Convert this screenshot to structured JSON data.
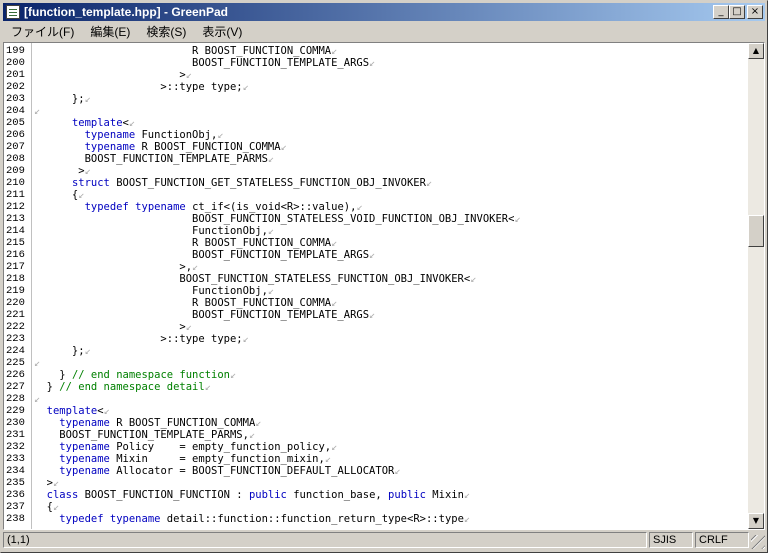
{
  "window": {
    "title": "[function_template.hpp] - GreenPad",
    "minimize": "_",
    "maximize": "□",
    "close": "×"
  },
  "menu": [
    "ファイル(F)",
    "編集(E)",
    "検索(S)",
    "表示(V)"
  ],
  "editor": {
    "eol_marker": "↙",
    "lines": [
      {
        "n": "199",
        "segs": [
          [
            "",
            "                         R BOOST_FUNCTION_COMMA"
          ]
        ]
      },
      {
        "n": "200",
        "segs": [
          [
            "",
            "                         BOOST_FUNCTION_TEMPLATE_ARGS"
          ]
        ]
      },
      {
        "n": "201",
        "segs": [
          [
            "",
            "                       >"
          ]
        ]
      },
      {
        "n": "202",
        "segs": [
          [
            "",
            "                    >::type type;"
          ]
        ]
      },
      {
        "n": "203",
        "segs": [
          [
            "",
            "      };"
          ]
        ]
      },
      {
        "n": "204",
        "segs": []
      },
      {
        "n": "205",
        "segs": [
          [
            "",
            "      "
          ],
          [
            "kw",
            "template"
          ],
          [
            "",
            "<"
          ]
        ]
      },
      {
        "n": "206",
        "segs": [
          [
            "",
            "        "
          ],
          [
            "kw",
            "typename"
          ],
          [
            "",
            " FunctionObj,"
          ]
        ]
      },
      {
        "n": "207",
        "segs": [
          [
            "",
            "        "
          ],
          [
            "kw",
            "typename"
          ],
          [
            "",
            " R BOOST_FUNCTION_COMMA"
          ]
        ]
      },
      {
        "n": "208",
        "segs": [
          [
            "",
            "        BOOST_FUNCTION_TEMPLATE_PARMS"
          ]
        ]
      },
      {
        "n": "209",
        "segs": [
          [
            "",
            "       >"
          ]
        ]
      },
      {
        "n": "210",
        "segs": [
          [
            "",
            "      "
          ],
          [
            "kw",
            "struct"
          ],
          [
            "",
            " BOOST_FUNCTION_GET_STATELESS_FUNCTION_OBJ_INVOKER"
          ]
        ]
      },
      {
        "n": "211",
        "segs": [
          [
            "",
            "      {"
          ]
        ]
      },
      {
        "n": "212",
        "segs": [
          [
            "",
            "        "
          ],
          [
            "kw",
            "typedef"
          ],
          [
            "",
            " "
          ],
          [
            "kw",
            "typename"
          ],
          [
            "",
            " ct_if<(is_void<R>::value),"
          ]
        ]
      },
      {
        "n": "213",
        "segs": [
          [
            "",
            "                         BOOST_FUNCTION_STATELESS_VOID_FUNCTION_OBJ_INVOKER<"
          ]
        ]
      },
      {
        "n": "214",
        "segs": [
          [
            "",
            "                         FunctionObj,"
          ]
        ]
      },
      {
        "n": "215",
        "segs": [
          [
            "",
            "                         R BOOST_FUNCTION_COMMA"
          ]
        ]
      },
      {
        "n": "216",
        "segs": [
          [
            "",
            "                         BOOST_FUNCTION_TEMPLATE_ARGS"
          ]
        ]
      },
      {
        "n": "217",
        "segs": [
          [
            "",
            "                       >,"
          ]
        ]
      },
      {
        "n": "218",
        "segs": [
          [
            "",
            "                       BOOST_FUNCTION_STATELESS_FUNCTION_OBJ_INVOKER<"
          ]
        ]
      },
      {
        "n": "219",
        "segs": [
          [
            "",
            "                         FunctionObj,"
          ]
        ]
      },
      {
        "n": "220",
        "segs": [
          [
            "",
            "                         R BOOST_FUNCTION_COMMA"
          ]
        ]
      },
      {
        "n": "221",
        "segs": [
          [
            "",
            "                         BOOST_FUNCTION_TEMPLATE_ARGS"
          ]
        ]
      },
      {
        "n": "222",
        "segs": [
          [
            "",
            "                       >"
          ]
        ]
      },
      {
        "n": "223",
        "segs": [
          [
            "",
            "                    >::type type;"
          ]
        ]
      },
      {
        "n": "224",
        "segs": [
          [
            "",
            "      };"
          ]
        ]
      },
      {
        "n": "225",
        "segs": []
      },
      {
        "n": "226",
        "segs": [
          [
            "",
            "    } "
          ],
          [
            "cm",
            "// end namespace function"
          ]
        ]
      },
      {
        "n": "227",
        "segs": [
          [
            "",
            "  } "
          ],
          [
            "cm",
            "// end namespace detail"
          ]
        ]
      },
      {
        "n": "228",
        "segs": []
      },
      {
        "n": "229",
        "segs": [
          [
            "",
            "  "
          ],
          [
            "kw",
            "template"
          ],
          [
            "",
            "<"
          ]
        ]
      },
      {
        "n": "230",
        "segs": [
          [
            "",
            "    "
          ],
          [
            "kw",
            "typename"
          ],
          [
            "",
            " R BOOST_FUNCTION_COMMA"
          ]
        ]
      },
      {
        "n": "231",
        "segs": [
          [
            "",
            "    BOOST_FUNCTION_TEMPLATE_PARMS,"
          ]
        ]
      },
      {
        "n": "232",
        "segs": [
          [
            "",
            "    "
          ],
          [
            "kw",
            "typename"
          ],
          [
            "",
            " Policy    = empty_function_policy,"
          ]
        ]
      },
      {
        "n": "233",
        "segs": [
          [
            "",
            "    "
          ],
          [
            "kw",
            "typename"
          ],
          [
            "",
            " Mixin     = empty_function_mixin,"
          ]
        ]
      },
      {
        "n": "234",
        "segs": [
          [
            "",
            "    "
          ],
          [
            "kw",
            "typename"
          ],
          [
            "",
            " Allocator = BOOST_FUNCTION_DEFAULT_ALLOCATOR"
          ]
        ]
      },
      {
        "n": "235",
        "segs": [
          [
            "",
            "  >"
          ]
        ]
      },
      {
        "n": "236",
        "segs": [
          [
            "",
            "  "
          ],
          [
            "kw",
            "class"
          ],
          [
            "",
            " BOOST_FUNCTION_FUNCTION : "
          ],
          [
            "kw",
            "public"
          ],
          [
            "",
            " function_base, "
          ],
          [
            "kw",
            "public"
          ],
          [
            "",
            " Mixin"
          ]
        ]
      },
      {
        "n": "237",
        "segs": [
          [
            "",
            "  {"
          ]
        ]
      },
      {
        "n": "238",
        "segs": [
          [
            "",
            "    "
          ],
          [
            "kw",
            "typedef"
          ],
          [
            "",
            " "
          ],
          [
            "kw",
            "typename"
          ],
          [
            "",
            " detail::function::function_return_type<R>::type"
          ]
        ]
      }
    ]
  },
  "scrollbar": {
    "up": "▲",
    "down": "▼",
    "position": 0.37
  },
  "status": {
    "position": "(1,1)",
    "encoding": "SJIS",
    "line_ending": "CRLF"
  }
}
